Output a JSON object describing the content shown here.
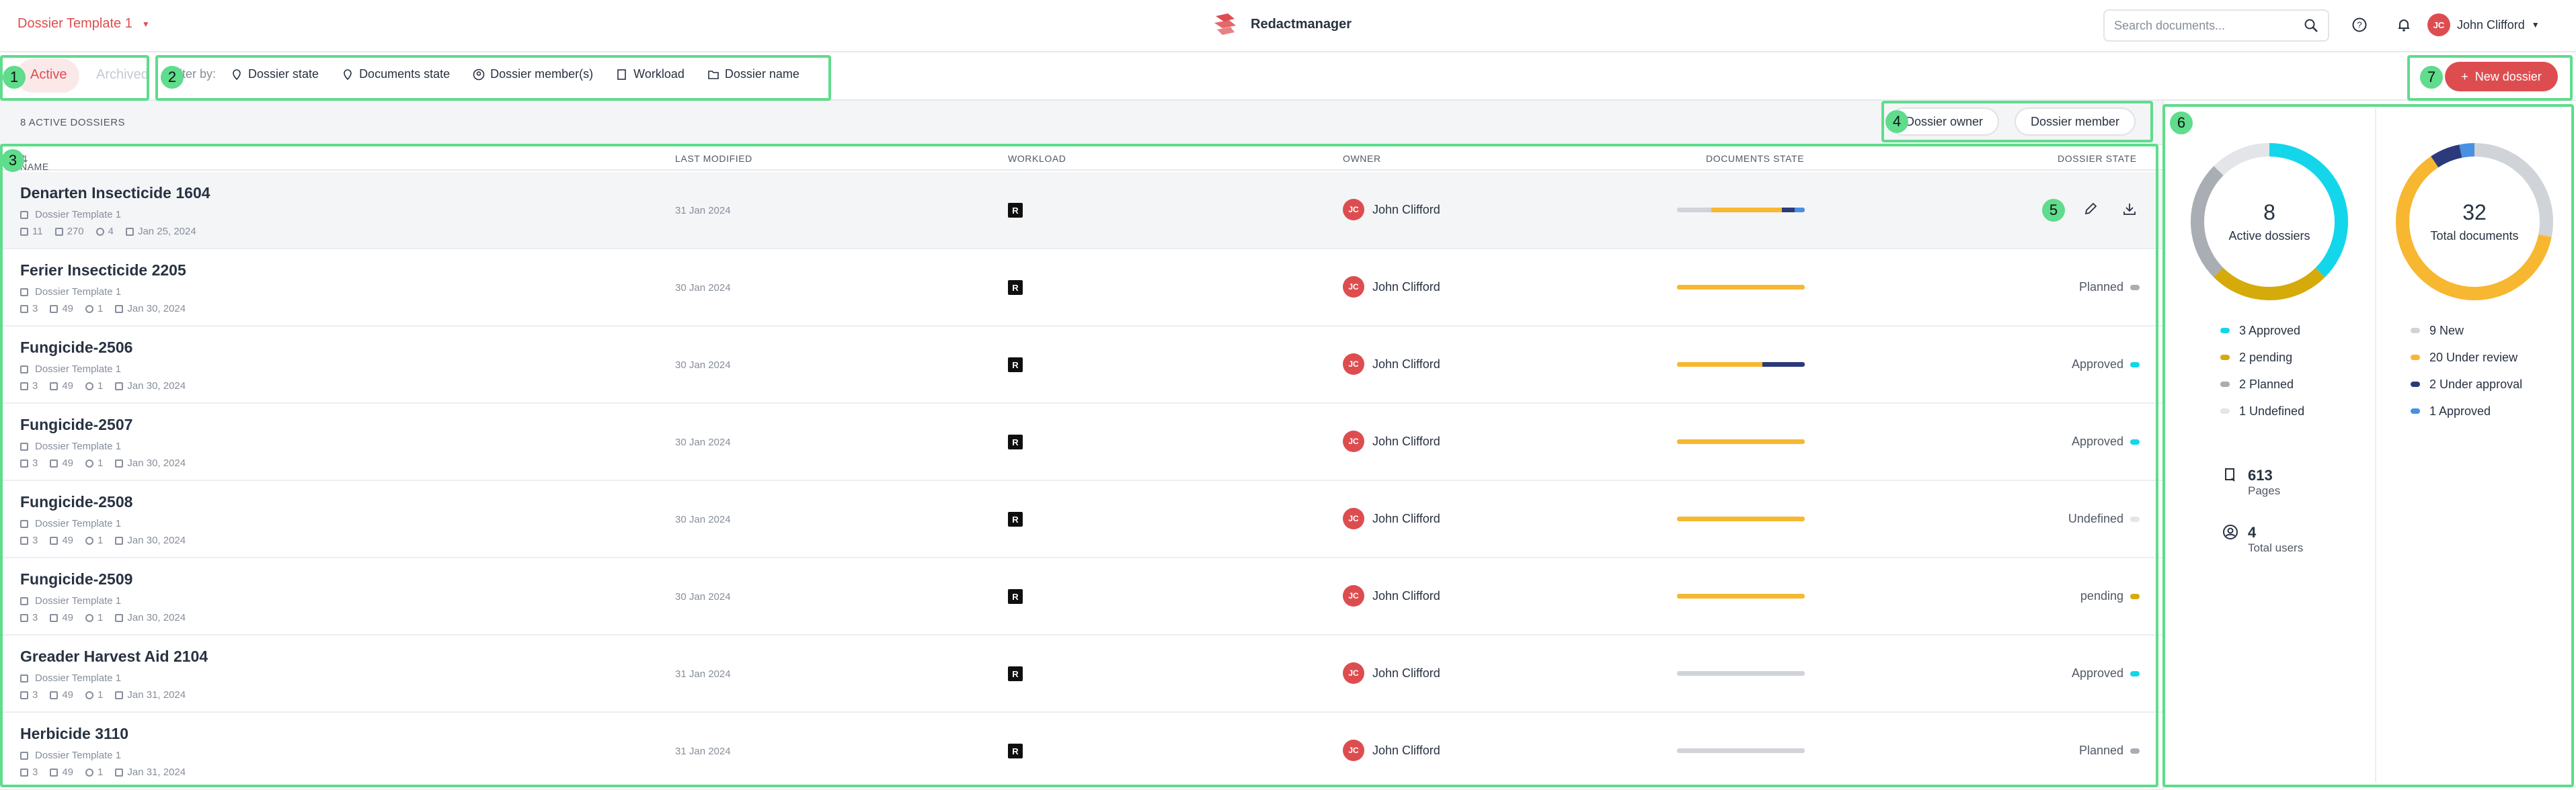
{
  "topbar": {
    "template_label": "Dossier Template 1",
    "brand_name": "Redactmanager",
    "search_placeholder": "Search documents...",
    "user_initials": "JC",
    "user_name": "John Clifford"
  },
  "tabs": {
    "active": "Active",
    "archived": "Archived"
  },
  "filters": {
    "label": "Filter by:",
    "items": [
      "Dossier state",
      "Documents state",
      "Dossier member(s)",
      "Workload",
      "Dossier name"
    ]
  },
  "new_dossier_label": "New dossier",
  "list": {
    "count_label": "8 ACTIVE DOSSIERS",
    "chip_owner": "Dossier owner",
    "chip_member": "Dossier member",
    "columns": [
      "NAME",
      "LAST MODIFIED",
      "WORKLOAD",
      "OWNER",
      "DOCUMENTS STATE",
      "DOSSIER STATE"
    ],
    "rows": [
      {
        "name": "Denarten Insecticide 1604",
        "template": "Dossier Template 1",
        "docs": "11",
        "pages": "270",
        "members": "4",
        "date": "Jan 25, 2024",
        "modified": "31 Jan 2024",
        "workload": "R",
        "owner": "John Clifford",
        "owner_initials": "JC",
        "state": "",
        "state_color": "",
        "bar": [
          [
            "#d0d3d8",
            0.27
          ],
          [
            "#f7b731",
            0.55
          ],
          [
            "#2b3a7a",
            0.1
          ],
          [
            "#4a90e2",
            0.08
          ]
        ]
      },
      {
        "name": "Ferier Insecticide 2205",
        "template": "Dossier Template 1",
        "docs": "3",
        "pages": "49",
        "members": "1",
        "date": "Jan 30, 2024",
        "modified": "30 Jan 2024",
        "workload": "R",
        "owner": "John Clifford",
        "owner_initials": "JC",
        "state": "Planned",
        "state_color": "#a9adb4",
        "bar": [
          [
            "#f7b731",
            1
          ]
        ]
      },
      {
        "name": "Fungicide-2506",
        "template": "Dossier Template 1",
        "docs": "3",
        "pages": "49",
        "members": "1",
        "date": "Jan 30, 2024",
        "modified": "30 Jan 2024",
        "workload": "R",
        "owner": "John Clifford",
        "owner_initials": "JC",
        "state": "Approved",
        "state_color": "#14d6ea",
        "bar": [
          [
            "#f7b731",
            0.67
          ],
          [
            "#2b3a7a",
            0.33
          ]
        ]
      },
      {
        "name": "Fungicide-2507",
        "template": "Dossier Template 1",
        "docs": "3",
        "pages": "49",
        "members": "1",
        "date": "Jan 30, 2024",
        "modified": "30 Jan 2024",
        "workload": "R",
        "owner": "John Clifford",
        "owner_initials": "JC",
        "state": "Approved",
        "state_color": "#14d6ea",
        "bar": [
          [
            "#f7b731",
            1
          ]
        ]
      },
      {
        "name": "Fungicide-2508",
        "template": "Dossier Template 1",
        "docs": "3",
        "pages": "49",
        "members": "1",
        "date": "Jan 30, 2024",
        "modified": "30 Jan 2024",
        "workload": "R",
        "owner": "John Clifford",
        "owner_initials": "JC",
        "state": "Undefined",
        "state_color": "#e3e5e8",
        "bar": [
          [
            "#f7b731",
            1
          ]
        ]
      },
      {
        "name": "Fungicide-2509",
        "template": "Dossier Template 1",
        "docs": "3",
        "pages": "49",
        "members": "1",
        "date": "Jan 30, 2024",
        "modified": "30 Jan 2024",
        "workload": "R",
        "owner": "John Clifford",
        "owner_initials": "JC",
        "state": "pending",
        "state_color": "#d5aa0b",
        "bar": [
          [
            "#f7b731",
            1
          ]
        ]
      },
      {
        "name": "Greader Harvest Aid 2104",
        "template": "Dossier Template 1",
        "docs": "3",
        "pages": "49",
        "members": "1",
        "date": "Jan 31, 2024",
        "modified": "31 Jan 2024",
        "workload": "R",
        "owner": "John Clifford",
        "owner_initials": "JC",
        "state": "Approved",
        "state_color": "#14d6ea",
        "bar": [
          [
            "#d0d3d8",
            1
          ]
        ]
      },
      {
        "name": "Herbicide 3110",
        "template": "Dossier Template 1",
        "docs": "3",
        "pages": "49",
        "members": "1",
        "date": "Jan 31, 2024",
        "modified": "31 Jan 2024",
        "workload": "R",
        "owner": "John Clifford",
        "owner_initials": "JC",
        "state": "Planned",
        "state_color": "#a9adb4",
        "bar": [
          [
            "#d0d3d8",
            1
          ]
        ]
      }
    ]
  },
  "panel": {
    "dossiers": {
      "total": "8",
      "label": "Active dossiers",
      "segments": [
        {
          "label": "3 Approved",
          "value": 3,
          "color": "#14d6ea"
        },
        {
          "label": "2 pending",
          "value": 2,
          "color": "#d5aa0b"
        },
        {
          "label": "2 Planned",
          "value": 2,
          "color": "#a9adb4"
        },
        {
          "label": "1 Undefined",
          "value": 1,
          "color": "#e3e5e8"
        }
      ]
    },
    "documents": {
      "total": "32",
      "label": "Total documents",
      "segments": [
        {
          "label": "9 New",
          "value": 9,
          "color": "#d0d3d8"
        },
        {
          "label": "20 Under review",
          "value": 20,
          "color": "#f7b731"
        },
        {
          "label": "2 Under approval",
          "value": 2,
          "color": "#2b3a7a"
        },
        {
          "label": "1 Approved",
          "value": 1,
          "color": "#4a90e2"
        }
      ]
    },
    "pages_value": "613",
    "pages_label": "Pages",
    "users_value": "4",
    "users_label": "Total users"
  },
  "annotations": [
    "1",
    "2",
    "3",
    "4",
    "5",
    "6",
    "7"
  ]
}
